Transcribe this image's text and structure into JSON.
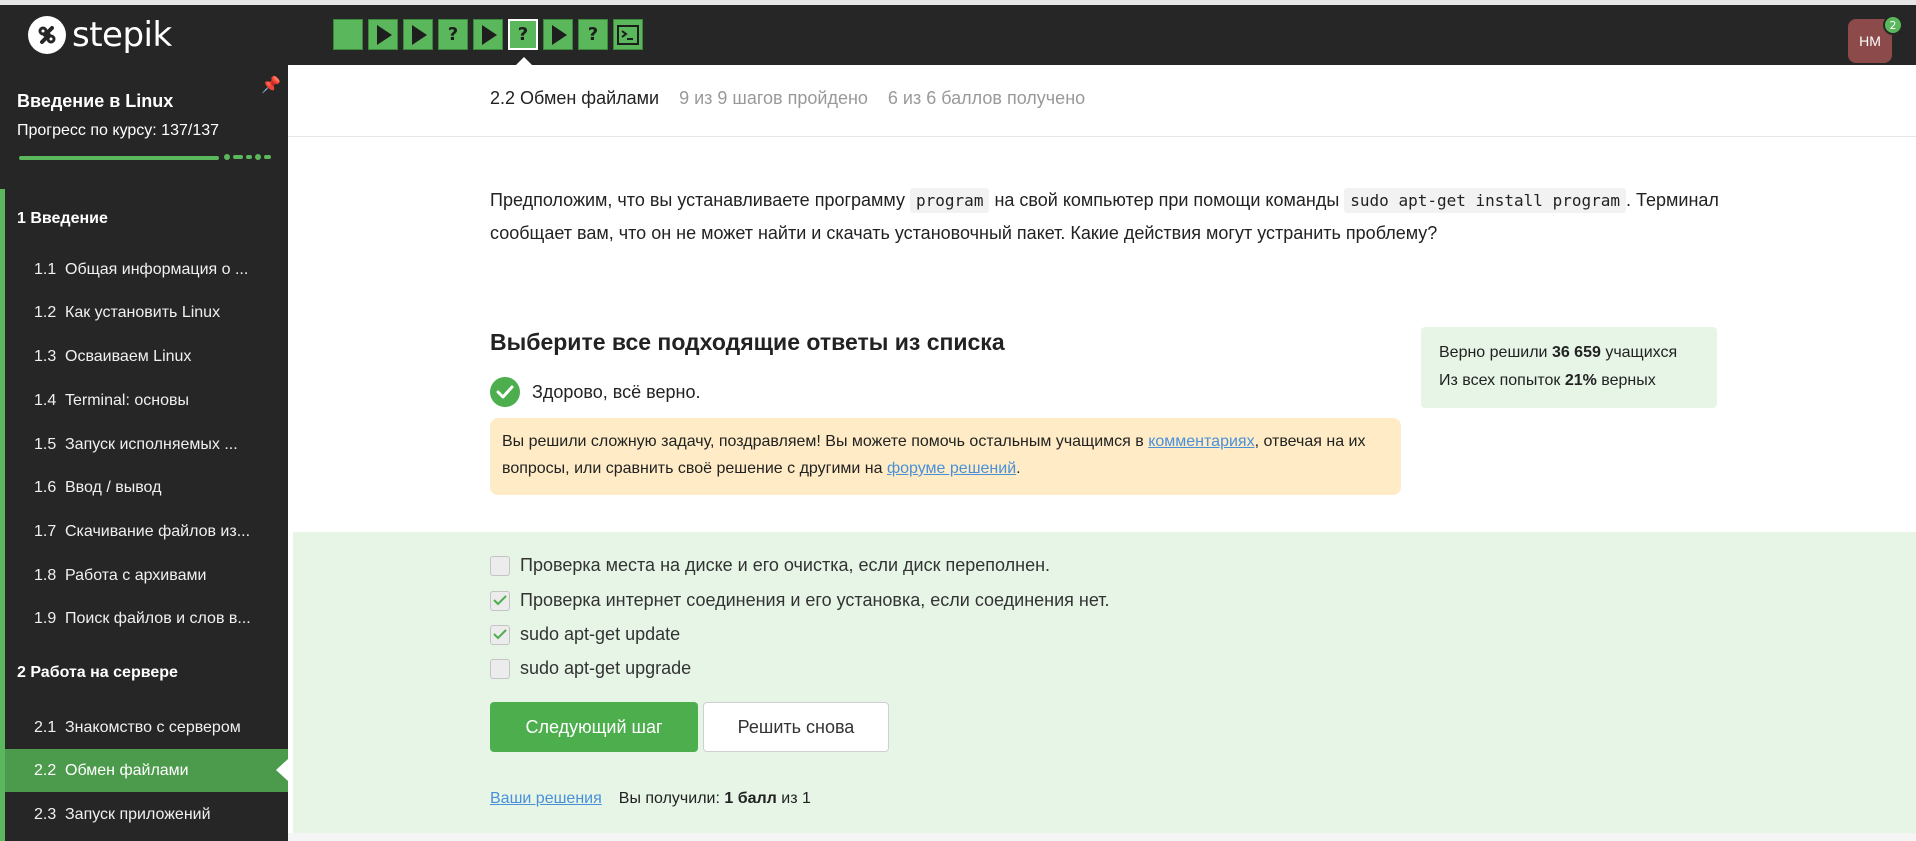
{
  "brand": {
    "name": "stepik"
  },
  "steps": [
    {
      "kind": "blank",
      "icon": "blank-step-icon"
    },
    {
      "kind": "play",
      "icon": "play-icon"
    },
    {
      "kind": "play",
      "icon": "play-icon"
    },
    {
      "kind": "quiz",
      "label": "?",
      "icon": "question-icon"
    },
    {
      "kind": "play",
      "icon": "play-icon"
    },
    {
      "kind": "quiz",
      "label": "?",
      "icon": "question-icon",
      "current": true
    },
    {
      "kind": "play",
      "icon": "play-icon"
    },
    {
      "kind": "quiz",
      "label": "?",
      "icon": "question-icon"
    },
    {
      "kind": "terminal",
      "icon": "terminal-icon"
    }
  ],
  "user": {
    "initials": "HM",
    "notifications": "2"
  },
  "sidebar": {
    "course_title": "Введение в Linux",
    "progress_text": "Прогресс по курсу:  137/137",
    "progress": 1.0,
    "sections": [
      {
        "label": "1  Введение"
      },
      {
        "label": "2  Работа на сервере"
      }
    ],
    "lessons": [
      {
        "num": "1.1",
        "title": "Общая информация о ..."
      },
      {
        "num": "1.2",
        "title": "Как установить Linux"
      },
      {
        "num": "1.3",
        "title": "Осваиваем Linux"
      },
      {
        "num": "1.4",
        "title": "Terminal: основы"
      },
      {
        "num": "1.5",
        "title": "Запуск исполняемых ..."
      },
      {
        "num": "1.6",
        "title": "Ввод / вывод"
      },
      {
        "num": "1.7",
        "title": "Скачивание файлов из..."
      },
      {
        "num": "1.8",
        "title": "Работа с архивами"
      },
      {
        "num": "1.9",
        "title": "Поиск файлов и слов в..."
      },
      {
        "num": "2.1",
        "title": "Знакомство с сервером"
      },
      {
        "num": "2.2",
        "title": "Обмен файлами",
        "active": true
      },
      {
        "num": "2.3",
        "title": "Запуск приложений"
      }
    ]
  },
  "lesson_header": {
    "title": "2.2 Обмен файлами",
    "steps_done": "9 из 9 шагов пройдено",
    "points": "6 из 6 баллов  получено"
  },
  "question": {
    "part1": "Предположим, что вы устанавливаете программу ",
    "code1": "program",
    "part2": " на свой компьютер при помощи команды ",
    "code2": "sudo apt-get install program",
    "part3": ". Терминал сообщает вам, что он не может найти и скачать установочный пакет. Какие действия могут устранить проблему?"
  },
  "choose_title": "Выберите все подходящие ответы из списка",
  "correct_msg": "Здорово, всё верно.",
  "notice": {
    "text1": "Вы решили сложную задачу, поздравляем! Вы можете помочь остальным учащимся в ",
    "link1": "комментариях",
    "text2": ", отвечая на их вопросы, или сравнить своё решение с другими на ",
    "link2": "форуме решений",
    "text3": "."
  },
  "stats": {
    "line1_prefix": "Верно решили ",
    "line1_value": "36 659",
    "line1_suffix": " учащихся",
    "line2_prefix": "Из всех попыток ",
    "line2_value": "21%",
    "line2_suffix": " верных"
  },
  "options": [
    {
      "label": "Проверка места на диске и его очистка, если диск переполнен.",
      "checked": false
    },
    {
      "label": "Проверка интернет соединения и его установка, если соединения нет.",
      "checked": true
    },
    {
      "label": "sudo apt-get update",
      "checked": true
    },
    {
      "label": "sudo apt-get upgrade",
      "checked": false
    }
  ],
  "buttons": {
    "next": "Следующий шаг",
    "retry": "Решить снова"
  },
  "result": {
    "solutions_link": "Ваши решения",
    "prefix": "Вы получили: ",
    "score": "1 балл",
    "suffix": " из 1"
  },
  "colors": {
    "accent": "#5bb75b",
    "sidebar": "#262626",
    "notice": "#ffecc6",
    "answers_bg": "#e6f5e6",
    "avatar": "#8c4a4a"
  }
}
